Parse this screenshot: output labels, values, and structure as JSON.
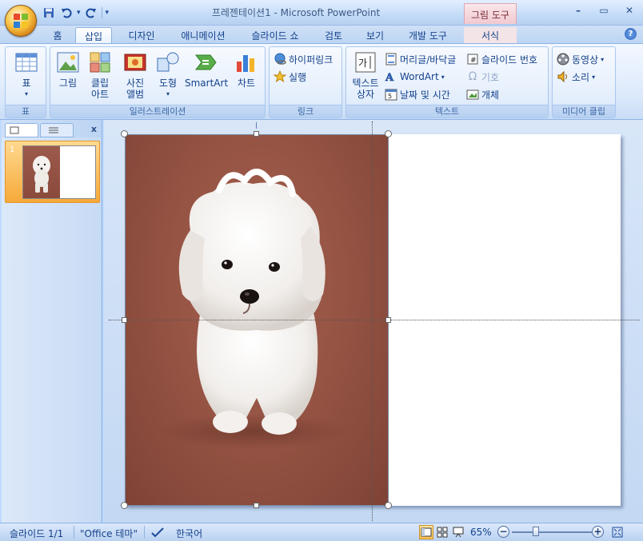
{
  "window": {
    "title": "프레젠테이션1 - Microsoft PowerPoint",
    "contextual_tab_group": "그림 도구"
  },
  "quick_access": {
    "save_icon": "save-icon",
    "undo_icon": "undo-icon",
    "redo_icon": "redo-icon"
  },
  "tabs": [
    {
      "label": "홈"
    },
    {
      "label": "삽입"
    },
    {
      "label": "디자인"
    },
    {
      "label": "애니메이션"
    },
    {
      "label": "슬라이드 쇼"
    },
    {
      "label": "검토"
    },
    {
      "label": "보기"
    },
    {
      "label": "개발 도구"
    },
    {
      "label": "서식"
    }
  ],
  "active_tab": "삽입",
  "ribbon": {
    "groups": {
      "table": {
        "label": "표",
        "table_btn": "표"
      },
      "illustrations": {
        "label": "일러스트레이션",
        "picture": "그림",
        "clipart_1": "클립",
        "clipart_2": "아트",
        "album_1": "사진",
        "album_2": "앨범",
        "shapes": "도형",
        "smartart": "SmartArt",
        "chart": "차트"
      },
      "links": {
        "label": "링크",
        "hyperlink": "하이퍼링크",
        "action": "실행"
      },
      "text": {
        "label": "텍스트",
        "textbox_1": "텍스트",
        "textbox_2": "상자",
        "header_footer": "머리글/바닥글",
        "wordart": "WordArt",
        "datetime": "날짜 및 시간",
        "slide_number": "슬라이드 번호",
        "symbol": "기호",
        "object": "개체"
      },
      "media": {
        "label": "미디어 클립",
        "movie": "동영상",
        "sound": "소리"
      }
    }
  },
  "slide_pane": {
    "slide_number": "1"
  },
  "status": {
    "slide": "슬라이드 1/1",
    "theme": "\"Office 테마\"",
    "language": "한국어",
    "zoom": "65%"
  },
  "colors": {
    "accent": "#15428b",
    "ribbon_border": "#8db2e3",
    "picture_background": "#965444",
    "selection_handle": "#ffffff"
  }
}
